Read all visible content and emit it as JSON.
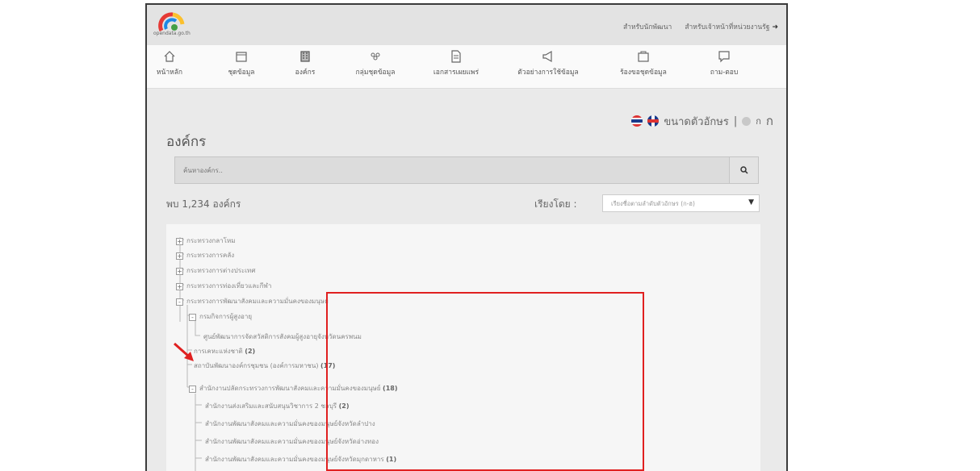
{
  "header": {
    "logo_text": "opendata.go.th",
    "links": [
      "สำหรับนักพัฒนา",
      "สำหรับเจ้าหน้าที่หน่วยงานรัฐ"
    ]
  },
  "nav": [
    {
      "label": "หน้าหลัก",
      "icon": "home-icon"
    },
    {
      "label": "ชุดข้อมูล",
      "icon": "folder-icon"
    },
    {
      "label": "องค์กร",
      "icon": "building-icon"
    },
    {
      "label": "กลุ่มชุดข้อมูล",
      "icon": "group-icon"
    },
    {
      "label": "เอกสารเผยแพร่",
      "icon": "document-icon"
    },
    {
      "label": "ตัวอย่างการใช้ข้อมูล",
      "icon": "megaphone-icon"
    },
    {
      "label": "ร้องขอชุดข้อมูล",
      "icon": "request-icon"
    },
    {
      "label": "ถาม-ตอบ",
      "icon": "chat-icon"
    }
  ],
  "toolbar": {
    "font_size_label": "ขนาดตัวอักษร",
    "separator": "|",
    "size_small": "ก",
    "size_large": "ก"
  },
  "page": {
    "title": "องค์กร",
    "search_placeholder": "ค้นหาองค์กร..",
    "found": "พบ 1,234 องค์กร",
    "sort_label": "เรียงโดย :",
    "sort_value": "เรียงชื่อตามลำดับตัวอักษร (ก-ฮ)"
  },
  "tree": [
    {
      "label": "กระทรวงกลาโหม",
      "toggle": "+",
      "level": 0,
      "count": ""
    },
    {
      "label": "กระทรวงการคลัง",
      "toggle": "+",
      "level": 0,
      "count": ""
    },
    {
      "label": "กระทรวงการต่างประเทศ",
      "toggle": "+",
      "level": 0,
      "count": ""
    },
    {
      "label": "กระทรวงการท่องเที่ยวและกีฬา",
      "toggle": "+",
      "level": 0,
      "count": ""
    },
    {
      "label": "กระทรวงการพัฒนาสังคมและความมั่นคงของมนุษย์",
      "toggle": "-",
      "level": 0,
      "count": ""
    },
    {
      "label": "กรมกิจการผู้สูงอายุ",
      "toggle": "-",
      "level": 1,
      "count": ""
    },
    {
      "label": "ศูนย์พัฒนาการจัดสวัสดิการสังคมผู้สูงอายุจังหวัดนครพนม",
      "toggle": "",
      "level": 2,
      "count": ""
    },
    {
      "label": "การเคหะแห่งชาติ",
      "toggle": "",
      "level": 1,
      "count": "(2)"
    },
    {
      "label": "สถาบันพัฒนาองค์กรชุมชน (องค์การมหาชน)",
      "toggle": "",
      "level": 1,
      "count": "(17)"
    },
    {
      "label": "สำนักงานปลัดกระทรวงการพัฒนาสังคมและความมั่นคงของมนุษย์",
      "toggle": "-",
      "level": 1,
      "count": "(18)"
    },
    {
      "label": "สำนักงานส่งเสริมและสนับสนุนวิชาการ 2 ชลบุรี",
      "toggle": "",
      "level": 2,
      "count": "(2)"
    },
    {
      "label": "สำนักงานพัฒนาสังคมและความมั่นคงของมนุษย์จังหวัดลำปาง",
      "toggle": "",
      "level": 2,
      "count": ""
    },
    {
      "label": "สำนักงานพัฒนาสังคมและความมั่นคงของมนุษย์จังหวัดอ่างทอง",
      "toggle": "",
      "level": 2,
      "count": ""
    },
    {
      "label": "สำนักงานพัฒนาสังคมและความมั่นคงของมนุษย์จังหวัดมุกดาหาร",
      "toggle": "",
      "level": 2,
      "count": "(1)"
    }
  ],
  "colors": {
    "highlight": "#e02020",
    "accent": "#1a3a8a"
  }
}
